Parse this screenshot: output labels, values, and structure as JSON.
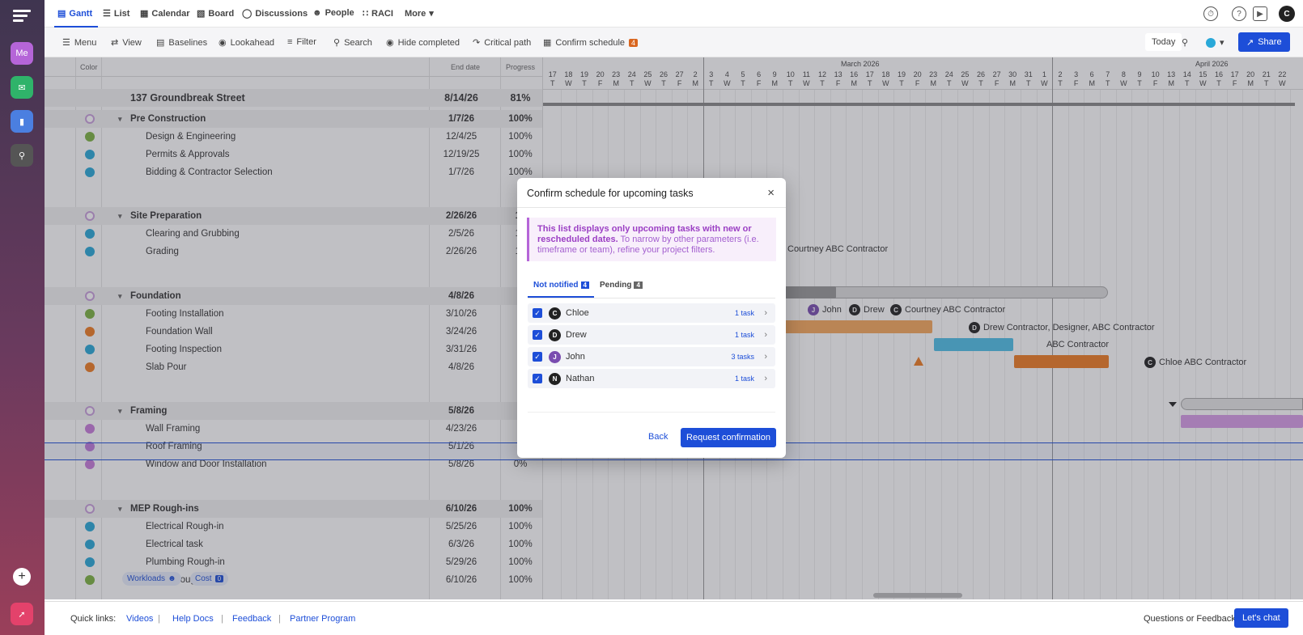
{
  "nav": {
    "tabs": [
      {
        "label": "Gantt",
        "icon": "gantt-icon"
      },
      {
        "label": "List",
        "icon": "list-icon"
      },
      {
        "label": "Calendar",
        "icon": "calendar-icon"
      },
      {
        "label": "Board",
        "icon": "board-icon"
      },
      {
        "label": "Discussions",
        "icon": "discussions-icon"
      },
      {
        "label": "People",
        "icon": "people-icon"
      },
      {
        "label": "RACI",
        "icon": "raci-icon"
      },
      {
        "label": "More",
        "icon": "chevron-down-icon"
      }
    ],
    "avatar": "C"
  },
  "sidebar": {
    "me": "Me"
  },
  "toolbar": {
    "menu": "Menu",
    "view": "View",
    "baselines": "Baselines",
    "lookahead": "Lookahead",
    "filter": "Filter",
    "search": "Search",
    "hide_completed": "Hide completed",
    "critical_path": "Critical path",
    "confirm_schedule": "Confirm schedule",
    "confirm_badge": "4",
    "today": "Today",
    "share": "Share"
  },
  "grid": {
    "headers": {
      "color": "Color",
      "end_date": "End date",
      "progress": "Progress"
    },
    "rows": [
      {
        "name": "137 Groundbreak Street",
        "end": "8/14/26",
        "progress": "81%",
        "type": "project"
      },
      {
        "name": "Pre Construction",
        "end": "1/7/26",
        "progress": "100%",
        "type": "group",
        "color": "ring"
      },
      {
        "name": "Design & Engineering",
        "end": "12/4/25",
        "progress": "100%",
        "type": "task",
        "color": "#7cb342"
      },
      {
        "name": "Permits & Approvals",
        "end": "12/19/25",
        "progress": "100%",
        "type": "task",
        "color": "#29a8d8"
      },
      {
        "name": "Bidding & Contractor Selection",
        "end": "1/7/26",
        "progress": "100%",
        "type": "task",
        "color": "#29a8d8"
      },
      {
        "name": "Site Preparation",
        "end": "2/26/26",
        "progress": "10",
        "type": "group",
        "color": "ring"
      },
      {
        "name": "Clearing and Grubbing",
        "end": "2/5/26",
        "progress": "10",
        "type": "task",
        "color": "#29a8d8"
      },
      {
        "name": "Grading",
        "end": "2/26/26",
        "progress": "10",
        "type": "task",
        "color": "#29a8d8"
      },
      {
        "name": "Foundation",
        "end": "4/8/26",
        "progress": "4",
        "type": "group",
        "color": "ring"
      },
      {
        "name": "Footing Installation",
        "end": "3/10/26",
        "progress": "7",
        "type": "task",
        "color": "#7cb342"
      },
      {
        "name": "Foundation Wall",
        "end": "3/24/26",
        "progress": "",
        "type": "task",
        "color": "#ef7d22"
      },
      {
        "name": "Footing Inspection",
        "end": "3/31/26",
        "progress": "",
        "type": "task",
        "color": "#29a8d8"
      },
      {
        "name": "Slab Pour",
        "end": "4/8/26",
        "progress": "",
        "type": "task",
        "color": "#ef7d22"
      },
      {
        "name": "Framing",
        "end": "5/8/26",
        "progress": "",
        "type": "group",
        "color": "ring"
      },
      {
        "name": "Wall Framing",
        "end": "4/23/26",
        "progress": "",
        "type": "task",
        "color": "#c77ddb"
      },
      {
        "name": "Roof Framing",
        "end": "5/1/26",
        "progress": "",
        "type": "task",
        "color": "#c77ddb"
      },
      {
        "name": "Window and Door Installation",
        "end": "5/8/26",
        "progress": "0%",
        "type": "task",
        "color": "#c77ddb"
      },
      {
        "name": "MEP Rough-ins",
        "end": "6/10/26",
        "progress": "100%",
        "type": "group",
        "color": "ring"
      },
      {
        "name": "Electrical Rough-in",
        "end": "5/25/26",
        "progress": "100%",
        "type": "task",
        "color": "#29a8d8"
      },
      {
        "name": "Electrical task",
        "end": "6/3/26",
        "progress": "100%",
        "type": "task",
        "color": "#29a8d8"
      },
      {
        "name": "Plumbing Rough-in",
        "end": "5/29/26",
        "progress": "100%",
        "type": "task",
        "color": "#29a8d8"
      },
      {
        "name": "HVAC Rough-in",
        "end": "6/10/26",
        "progress": "100%",
        "type": "task",
        "color": "#7cb342"
      }
    ],
    "workloads": "Workloads",
    "cost": "Cost",
    "cost_badge": "0"
  },
  "timeline": {
    "months": [
      "March 2026",
      "April 2026"
    ],
    "days": [
      "17",
      "18",
      "19",
      "20",
      "23",
      "24",
      "25",
      "26",
      "27",
      "2",
      "3",
      "4",
      "5",
      "6",
      "9",
      "10",
      "11",
      "12",
      "13",
      "16",
      "17",
      "18",
      "19",
      "20",
      "23",
      "24",
      "25",
      "26",
      "27",
      "30",
      "31",
      "1",
      "2",
      "3",
      "6",
      "7",
      "8",
      "9",
      "10",
      "13",
      "14",
      "15",
      "16",
      "17",
      "20",
      "21",
      "22"
    ],
    "weekdays": [
      "T",
      "W",
      "T",
      "F",
      "M",
      "T",
      "W",
      "T",
      "F",
      "M",
      "T",
      "W",
      "T",
      "F",
      "M",
      "T",
      "W",
      "T",
      "F",
      "M",
      "T",
      "W",
      "T",
      "F",
      "M",
      "T",
      "W",
      "T",
      "F",
      "M",
      "T",
      "W",
      "T",
      "F",
      "M",
      "T",
      "W",
      "T",
      "F",
      "M",
      "T",
      "W",
      "T",
      "F",
      "M",
      "T",
      "W"
    ],
    "labels": [
      {
        "avatar": "",
        "names": "Courtney  ABC Contractor"
      },
      {
        "avatar": "J",
        "names": "John"
      },
      {
        "avatar": "D",
        "names": "Drew"
      },
      {
        "avatar": "C",
        "names": "Courtney  ABC Contractor"
      },
      {
        "avatar": "D",
        "names": "Drew  Contractor, Designer, ABC Contractor"
      },
      {
        "avatar": "",
        "names": "ABC Contractor"
      },
      {
        "avatar": "C",
        "names": "Chloe  ABC Contractor"
      }
    ]
  },
  "modal": {
    "title": "Confirm schedule for upcoming tasks",
    "notice_bold": "This list displays only upcoming tasks with new or rescheduled dates.",
    "notice_rest": " To narrow by other parameters (i.e. timeframe or team), refine your project filters.",
    "tab_not_notified": "Not notified",
    "tab_not_notified_count": "4",
    "tab_pending": "Pending",
    "tab_pending_count": "4",
    "people": [
      {
        "initial": "C",
        "name": "Chloe",
        "count": "1  task"
      },
      {
        "initial": "D",
        "name": "Drew",
        "count": "1  task"
      },
      {
        "initial": "J",
        "name": "John",
        "count": "3 tasks"
      },
      {
        "initial": "N",
        "name": "Nathan",
        "count": "1  task"
      }
    ],
    "back": "Back",
    "request": "Request confirmation"
  },
  "footer": {
    "quick_links": "Quick links:",
    "videos": "Videos",
    "help_docs": "Help Docs",
    "feedback": "Feedback",
    "partner": "Partner Program",
    "questions": "Questions or Feedback?",
    "chat": "Let's chat"
  }
}
